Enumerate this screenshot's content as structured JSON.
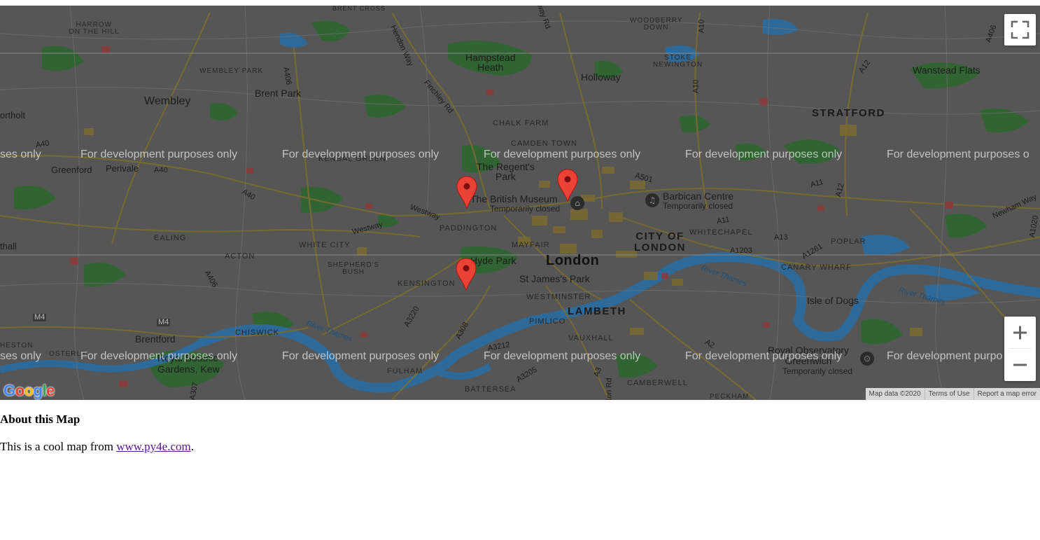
{
  "map": {
    "places": {
      "harrow": "HARROW\nON THE HILL",
      "wembley_park": "WEMBLEY PARK",
      "wembley": "Wembley",
      "brent_park": "Brent Park",
      "hampstead_heath": "Hampstead\nHeath",
      "holloway": "Holloway",
      "stoke_newington": "STOKE\nNEWINGTON",
      "woodberry_down": "WOODBERRY\nDOWN",
      "brent_cross": "BRENT CROSS",
      "wanstead_flats": "Wanstead Flats",
      "stratford": "STRATFORD",
      "northolt": "ortholt",
      "greenford": "Greenford",
      "perivale": "Perivale",
      "chalk_farm": "CHALK FARM",
      "camden_town": "CAMDEN TOWN",
      "kensal_green": "KENSAL GREEN",
      "regents_park": "The Regent's\nPark",
      "british_museum": "The British Museum",
      "british_museum_status": "Temporarily closed",
      "barbican_centre": "Barbican Centre",
      "barbican_status": "Temporarily closed",
      "whitechapel": "WHITECHAPEL",
      "city_of_london": "CITY OF\nLONDON",
      "poplar": "POPLAR",
      "paddington": "PADDINGTON",
      "ealing": "EALING",
      "white_city": "WHITE CITY",
      "acton": "ACTON",
      "mayfair": "MAYFAIR",
      "london": "London",
      "hyde_park": "Hyde Park",
      "southall": "thall",
      "shepherds_bush": "SHEPHERD'S\nBUSH",
      "kensington": "KENSINGTON",
      "st_james_park": "St James's Park",
      "westminster": "WESTMINSTER",
      "lambeth": "LAMBETH",
      "canary_wharf": "CANARY WHARF",
      "isle_of_dogs": "Isle of Dogs",
      "chiswick": "CHISWICK",
      "pimlico": "PIMLICO",
      "vauxhall": "VAUXHALL",
      "brentford": "Brentford",
      "royal_botanic": "Royal Botanic\nGardens, Kew",
      "heston": "HESTON",
      "osterley": "OSTERLE",
      "fulham": "FULHAM",
      "battersea": "BATTERSEA",
      "camberwell": "CAMBERWELL",
      "peckham": "PECKHAM",
      "royal_observatory": "Royal Observatory\nGreenwich",
      "royal_observatory_status": "Temporarily closed"
    },
    "roads": {
      "a10a": "A10",
      "a10b": "A10",
      "a406a": "A406",
      "a406b": "A406",
      "a406c": "A406",
      "a12a": "A12",
      "a12b": "A12",
      "a40a": "A40",
      "a40b": "A40",
      "a40c": "A40",
      "a501": "A501",
      "a11a": "A11",
      "a11b": "A11",
      "a13": "A13",
      "a1203": "A1203",
      "a1261": "A1261",
      "a1020": "A1020",
      "a3220": "A3220",
      "a308": "A308",
      "a3212": "A3212",
      "a3205": "A3205",
      "a2": "A2",
      "a3": "A3",
      "a307": "A307",
      "m4a": "M4",
      "m4b": "M4",
      "westway_a": "Westway",
      "westway_b": "Westway",
      "hendon_way": "Hendon Way",
      "finchley_rd": "Finchley Rd",
      "newham_way": "Newham Way",
      "way_rd": "way Rd",
      "kton_rd": "kton Rd"
    },
    "rivers": {
      "thames_east": "River Thames",
      "thames_central": "River Thames",
      "thames_west": "River Thames"
    },
    "watermark": "For development purposes only",
    "watermark_row1": [
      "ses only",
      "For development purposes only",
      "For development purposes only",
      "For development purposes only",
      "For development purposes only",
      "For development purposes o"
    ],
    "watermark_row2": [
      "ses only",
      "For development purposes only",
      "For development purposes only",
      "For development purposes only",
      "For development purposes only",
      "For development purpo"
    ],
    "markers": [
      "map-marker",
      "map-marker",
      "map-marker"
    ],
    "controls": {
      "fullscreen": "fullscreen-icon",
      "zoom_in": "+",
      "zoom_out": "−"
    },
    "attribution": {
      "map_data": "Map data ©2020",
      "terms": "Terms of Use",
      "report": "Report a map error"
    },
    "logo": {
      "letters": [
        "G",
        "o",
        "o",
        "g",
        "l",
        "e"
      ],
      "colors": [
        "#4285f4",
        "#ea4335",
        "#fbbc05",
        "#4285f4",
        "#34a853",
        "#ea4335"
      ]
    },
    "colors": {
      "overlay": "#565656",
      "parks": "#2f6b2f",
      "water": "#2e6a99",
      "roads": "#7a6a2e",
      "marker": "#ea4335"
    }
  },
  "about": {
    "heading": "About this Map",
    "text_before": "This is a cool map from ",
    "link": "www.py4e.com",
    "text_after": "."
  }
}
